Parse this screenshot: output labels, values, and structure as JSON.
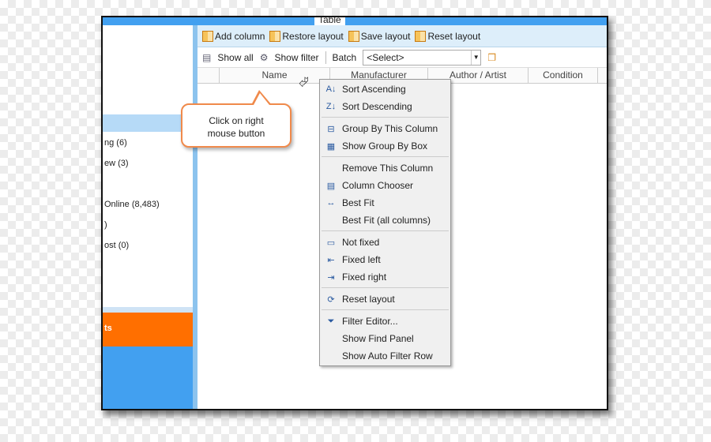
{
  "tab": "Table",
  "sidebar": {
    "items": [
      "ng (6)",
      "ew (3)",
      "Online (8,483)",
      ")",
      "ost (0)"
    ],
    "orange_label": "ts"
  },
  "toolbar": [
    {
      "label": "Add column",
      "icon": "add-column-icon"
    },
    {
      "label": "Restore layout",
      "icon": "restore-layout-icon"
    },
    {
      "label": "Save layout",
      "icon": "save-layout-icon"
    },
    {
      "label": "Reset layout",
      "icon": "reset-layout-icon"
    }
  ],
  "filterbar": {
    "show_all": "Show all",
    "show_filter": "Show filter",
    "batch": "Batch",
    "select_value": "<Select>"
  },
  "columns": [
    "Name",
    "Manufacturer",
    "Author / Artist",
    "Condition"
  ],
  "callout": {
    "line1": "Click on right",
    "line2": "mouse button"
  },
  "menu": [
    [
      {
        "label": "Sort Ascending",
        "icon": "sort-ascending-icon"
      },
      {
        "label": "Sort Descending",
        "icon": "sort-descending-icon"
      }
    ],
    [
      {
        "label": "Group By This Column",
        "icon": "group-by-icon"
      },
      {
        "label": "Show Group By Box",
        "icon": "group-box-icon"
      }
    ],
    [
      {
        "label": "Remove This Column",
        "icon": ""
      },
      {
        "label": "Column Chooser",
        "icon": "column-chooser-icon"
      },
      {
        "label": "Best Fit",
        "icon": "best-fit-icon"
      },
      {
        "label": "Best Fit (all columns)",
        "icon": ""
      }
    ],
    [
      {
        "label": "Not fixed",
        "icon": "not-fixed-icon"
      },
      {
        "label": "Fixed left",
        "icon": "fixed-left-icon"
      },
      {
        "label": "Fixed right",
        "icon": "fixed-right-icon"
      }
    ],
    [
      {
        "label": "Reset layout",
        "icon": "reset-layout-icon"
      }
    ],
    [
      {
        "label": "Filter Editor...",
        "icon": "filter-icon"
      },
      {
        "label": "Show Find Panel",
        "icon": ""
      },
      {
        "label": "Show Auto Filter Row",
        "icon": ""
      }
    ]
  ],
  "colors": {
    "accent": "#42a0f0",
    "orange": "#ff6f00",
    "callout_border": "#f08a4b",
    "toolbar_bg": "#ddeefa"
  }
}
